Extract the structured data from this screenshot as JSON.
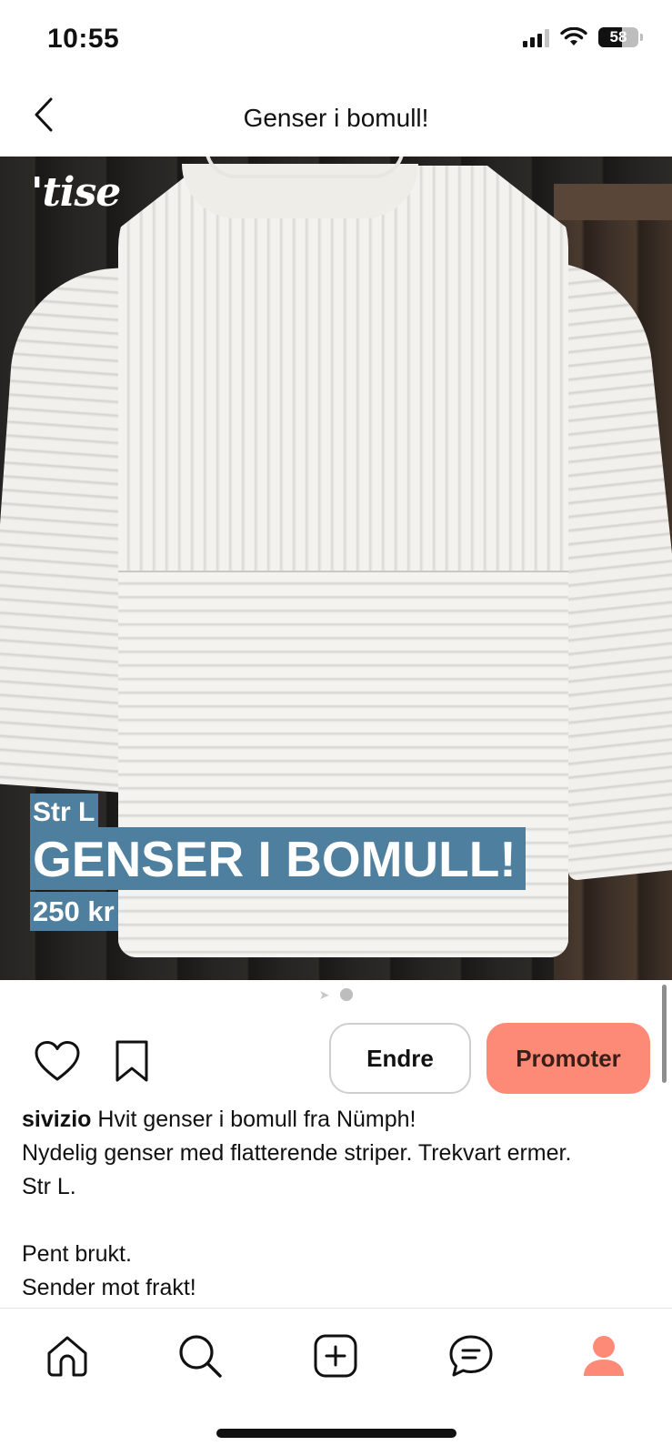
{
  "status_bar": {
    "time": "10:55",
    "battery_level": "58",
    "icons": [
      "cellular-signal-icon",
      "wifi-icon",
      "battery-icon"
    ]
  },
  "header": {
    "title": "Genser i bomull!",
    "back_icon": "chevron-left-icon"
  },
  "listing_image": {
    "brand": "'tise",
    "size_tag": "Str L",
    "title_tag": "GENSER I BOMULL!",
    "price_tag": "250 kr",
    "page_count": 2,
    "current_page": 2
  },
  "actions": {
    "like_icon": "heart-icon",
    "save_icon": "bookmark-icon",
    "edit_label": "Endre",
    "promote_label": "Promoter"
  },
  "description": {
    "username": "sivizio",
    "first_line": " Hvit genser i bomull fra Nümph!",
    "line2": "Nydelig genser med flatterende striper. Trekvart ermer.",
    "line3": "Str L.",
    "line4": "Pent brukt.",
    "line5": "Sender mot frakt!"
  },
  "bottom_nav": {
    "items": [
      "home-icon",
      "search-icon",
      "add-listing-icon",
      "messages-icon",
      "profile-icon"
    ],
    "active": "profile-icon"
  },
  "colors": {
    "accent": "#fd8a76",
    "tag_background": "#4e7f9e",
    "profile_active": "#fd8a76"
  }
}
